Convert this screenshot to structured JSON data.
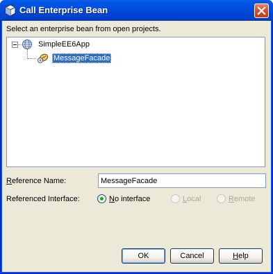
{
  "window": {
    "title": "Call Enterprise Bean",
    "icon": "bean-icon",
    "close": "close-icon"
  },
  "instruction": "Select an enterprise bean from open projects.",
  "tree": {
    "root": {
      "label": "SimpleEE6App",
      "icon": "globe-icon",
      "expanded": true
    },
    "child": {
      "label": "MessageFacade",
      "icon": "session-bean-icon",
      "selected": true
    }
  },
  "form": {
    "reference_name_label_u": "R",
    "reference_name_label_rest": "eference Name:",
    "reference_name_value": "MessageFacade",
    "interface_label": "Referenced Interface:",
    "options": [
      {
        "u": "N",
        "rest": "o interface",
        "checked": true,
        "enabled": true
      },
      {
        "u": "L",
        "rest": "ocal",
        "checked": false,
        "enabled": false
      },
      {
        "u": "R",
        "rest": "emote",
        "checked": false,
        "enabled": false
      }
    ]
  },
  "buttons": {
    "ok": "OK",
    "cancel": "Cancel",
    "help_u": "H",
    "help_rest": "elp"
  },
  "colors": {
    "titlebar": "#0050E0",
    "dialog_bg": "#ECE9D8",
    "selection": "#316AC5"
  }
}
